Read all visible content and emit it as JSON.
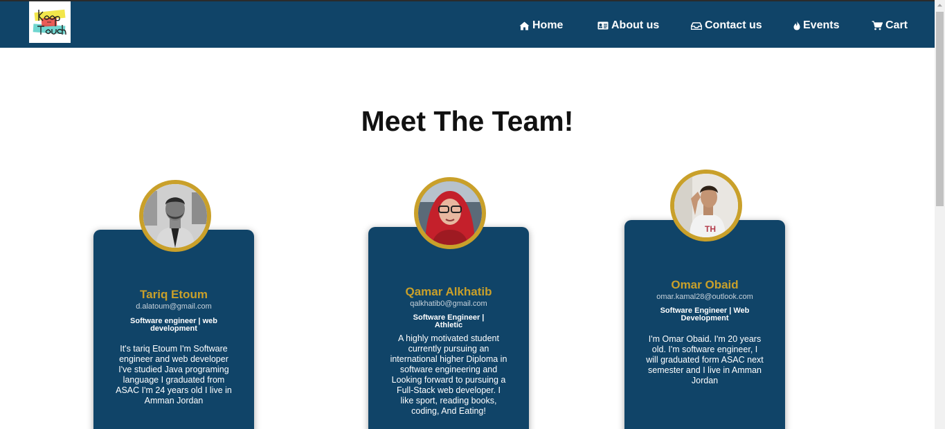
{
  "nav": {
    "logo_alt": "keep in touch",
    "items": [
      {
        "label": "Home",
        "icon": "home-icon"
      },
      {
        "label": "About us",
        "icon": "id-card-icon"
      },
      {
        "label": "Contact us",
        "icon": "inbox-icon"
      },
      {
        "label": "Events",
        "icon": "fire-icon"
      },
      {
        "label": "Cart",
        "icon": "cart-icon"
      }
    ]
  },
  "page": {
    "title": "Meet The Team!"
  },
  "team": [
    {
      "name": "Tariq Etoum",
      "email": "d.alatoum@gmail.com",
      "role": "Software engineer | web development",
      "bio": "It's tariq Etoum I'm Software engineer and web developer I've studied Java programing language I graduated from ASAC I'm 24 years old I live in Amman Jordan"
    },
    {
      "name": "Qamar Alkhatib",
      "email": "qalkhatib0@gmail.com",
      "role": "Software Engineer | Athletic",
      "bio": "A highly motivated student currently pursuing an international higher Diploma in software engineering and Looking forward to pursuing a Full-Stack web developer. I like sport, reading books, coding, And Eating!"
    },
    {
      "name": "Omar Obaid",
      "email": "omar.kamal28@outlook.com",
      "role": "Software Engineer | Web Development",
      "bio": "I'm Omar Obaid. I'm 20 years old. I'm software engineer, I will graduated form ASAC next semester and I live in Amman Jordan"
    }
  ],
  "colors": {
    "navbar": "#104468",
    "card": "#104468",
    "accent_gold": "#c9a02a",
    "text_white": "#ffffff"
  }
}
